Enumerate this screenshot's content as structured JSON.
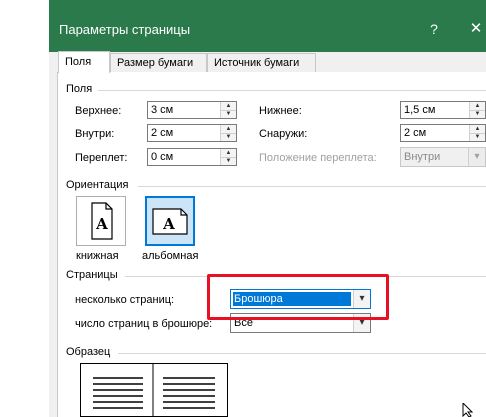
{
  "window": {
    "title": "Параметры страницы",
    "help": "?",
    "close": "✕"
  },
  "tabs": [
    {
      "label": "Поля",
      "active": true
    },
    {
      "label": "Размер бумаги",
      "active": false
    },
    {
      "label": "Источник бумаги",
      "active": false
    }
  ],
  "margins": {
    "section": "Поля",
    "top_label": "Верхнее:",
    "top_value": "3 см",
    "bottom_label": "Нижнее:",
    "bottom_value": "1,5 см",
    "inside_label": "Внутри:",
    "inside_value": "2 см",
    "outside_label": "Снаружи:",
    "outside_value": "2 см",
    "gutter_label": "Переплет:",
    "gutter_value": "0 см",
    "gutter_pos_label": "Положение переплета:",
    "gutter_pos_value": "Внутри"
  },
  "orientation": {
    "section": "Ориентация",
    "portrait": "книжная",
    "landscape": "альбомная",
    "selected": "landscape",
    "glyph": "A"
  },
  "pages": {
    "section": "Страницы",
    "multiple_label": "несколько страниц:",
    "multiple_value": "Брошюра",
    "booklet_label": "число страниц в брошюре:",
    "booklet_value": "Все"
  },
  "preview": {
    "section": "Образец"
  },
  "colors": {
    "title_bar": "#2b7a4b",
    "selection": "#0078d7",
    "highlight_box": "#e81123"
  }
}
